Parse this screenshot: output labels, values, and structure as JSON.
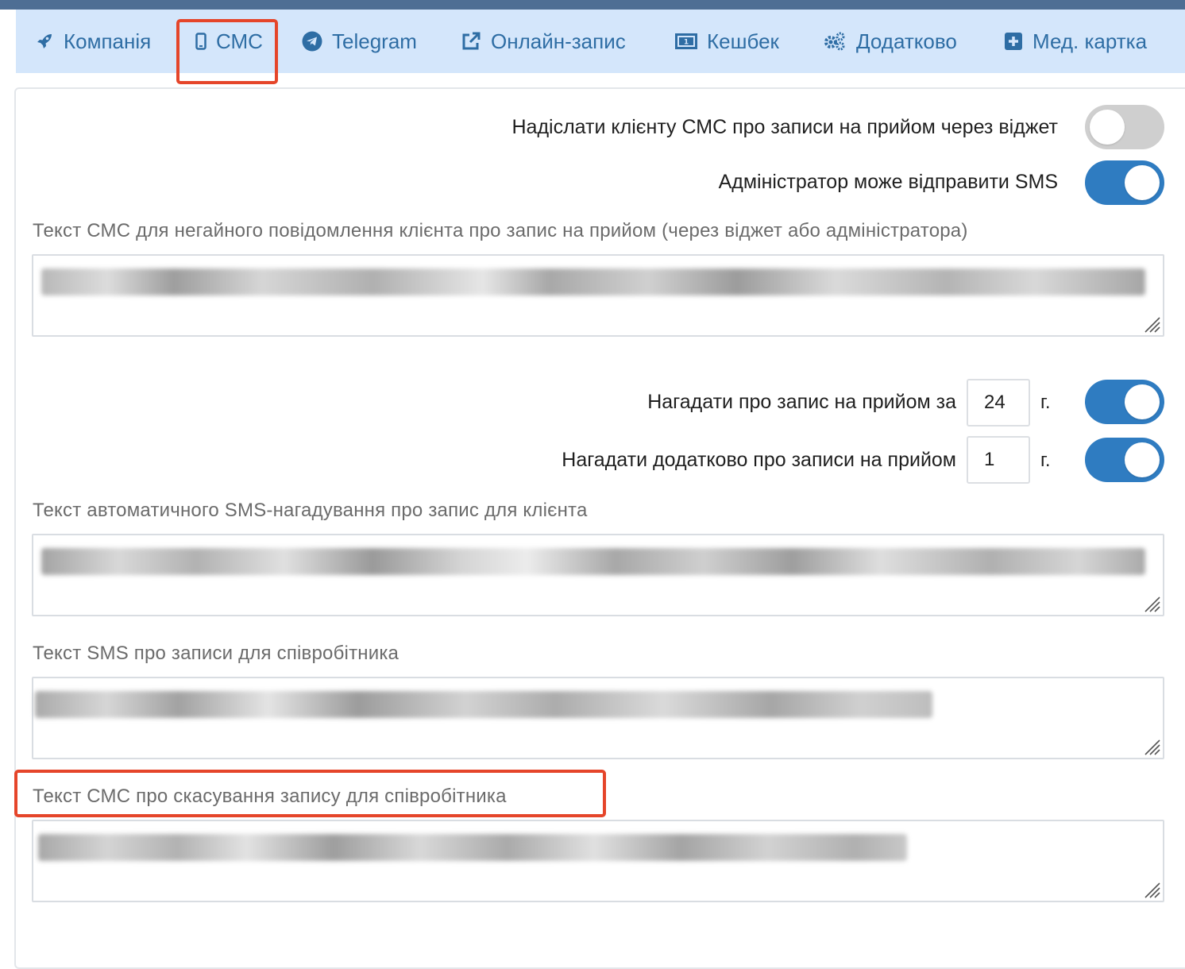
{
  "tabs": [
    {
      "id": "company",
      "label": "Компанія",
      "icon": "rocket-icon"
    },
    {
      "id": "sms",
      "label": "СМС",
      "icon": "mobile-phone-icon"
    },
    {
      "id": "telegram",
      "label": "Telegram",
      "icon": "telegram-icon"
    },
    {
      "id": "online",
      "label": "Онлайн-запис",
      "icon": "external-link-icon"
    },
    {
      "id": "cashback",
      "label": "Кешбек",
      "icon": "money-bill-icon"
    },
    {
      "id": "extra",
      "label": "Додатково",
      "icon": "gears-icon"
    },
    {
      "id": "medcard",
      "label": "Мед. картка",
      "icon": "plus-square-icon"
    }
  ],
  "settings": {
    "widget_sms": {
      "label": "Надіслати клієнту СМС про записи на прийом через віджет",
      "enabled": false
    },
    "admin_sms": {
      "label": "Адміністратор може відправити SMS",
      "enabled": true
    },
    "immediate_text": {
      "label": "Текст СМС для негайного повідомлення клієнта про запис на прийом (через віджет або адміністратора)"
    },
    "remind": {
      "label": "Нагадати про запис на прийом за",
      "value": "24",
      "unit": "г.",
      "enabled": true
    },
    "remind_extra": {
      "label": "Нагадати додатково про записи на прийом",
      "value": "1",
      "unit": "г.",
      "enabled": true
    },
    "auto_text": {
      "label": "Текст автоматичного SMS-нагадування про запис для клієнта"
    },
    "staff_text": {
      "label": "Текст SMS про записи для співробітника"
    },
    "cancel_text": {
      "label": "Текст СМС про скасування запису для співробітника"
    }
  },
  "colors": {
    "accent": "#2f7cc1",
    "highlight": "#e5452a",
    "tab_bg": "#d4e6fb",
    "tab_text": "#2e6da4"
  }
}
